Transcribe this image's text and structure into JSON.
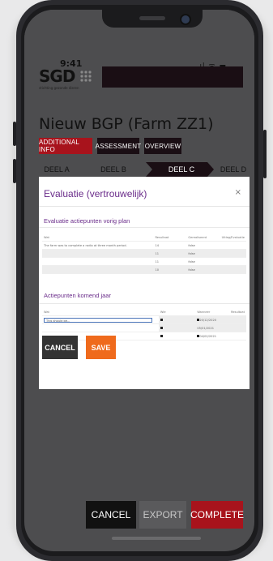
{
  "status_bar": {
    "time": "9:41",
    "icons": "..ıl ᯤ ▬"
  },
  "logo": {
    "text": "SGD",
    "tagline": "stichting gezonde dieren"
  },
  "page_title": "Nieuw BGP (Farm ZZ1)",
  "nav_tabs": [
    {
      "label": "ADDITIONAL INFO",
      "color": "#a8131c"
    },
    {
      "label": "ASSESSMENT",
      "color": "#1a0e14"
    },
    {
      "label": "OVERVIEW",
      "color": "#1a0e14"
    }
  ],
  "deel_tabs": [
    "DEEL A",
    "DEEL B",
    "DEEL C",
    "DEEL D"
  ],
  "modal": {
    "title": "Evaluatie (vertrouwelijk)",
    "close_symbol": "×",
    "section1": {
      "title": "Evaluatie actiepunten vorig plan",
      "headers": [
        "Wat",
        "Resultaat",
        "Gerealiseerd",
        "Uitleg/Evaluatie"
      ],
      "rows": [
        [
          "The farm was to complete a radio at three month period.",
          "14",
          "false",
          ""
        ],
        [
          "",
          "11",
          "false",
          ""
        ],
        [
          "",
          "11",
          "false",
          ""
        ],
        [
          "",
          "10",
          "false",
          ""
        ]
      ]
    },
    "section2": {
      "title": "Actiepunten komend jaar",
      "headers": [
        "Wat",
        "Wie",
        "Wanneer",
        "Resultaat"
      ],
      "input_value": "This should be...",
      "rows": [
        [
          "",
          "",
          "20/12/2020",
          ""
        ],
        [
          "",
          "",
          "05/01/2021",
          ""
        ],
        [
          "",
          "",
          "04/02/2021",
          ""
        ]
      ]
    },
    "cancel_label": "CANCEL",
    "save_label": "SAVE"
  },
  "footer": {
    "cancel_label": "CANCEL",
    "export_label": "EXPORT",
    "complete_label": "COMPLETE"
  },
  "colors": {
    "purple": "#6a2c8a",
    "orange": "#ef6a1c",
    "red": "#a8131c",
    "dark": "#1a0e14"
  }
}
